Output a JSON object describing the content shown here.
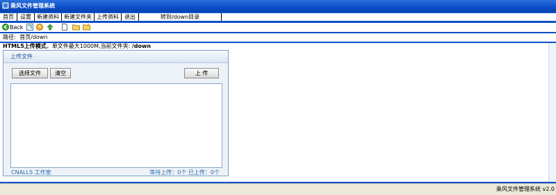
{
  "app": {
    "title": "乘风文件管理系统"
  },
  "menu": {
    "items": [
      {
        "label": "首页"
      },
      {
        "label": "设置"
      },
      {
        "label": "新建资料"
      },
      {
        "label": "新建文件夹"
      },
      {
        "label": "上传资料"
      },
      {
        "label": "退出"
      }
    ],
    "goto_label": "转到/down目录"
  },
  "toolbar": {
    "back_label": "Back",
    "icons": [
      "back-icon",
      "refresh-icon",
      "home-icon",
      "up-folder-icon",
      "new-file-icon",
      "open-folder-icon",
      "new-folder-icon"
    ]
  },
  "path": {
    "label": "路径:",
    "value": "首页/down"
  },
  "upload": {
    "mode_label": "HTML5上传模式",
    "info": "，单文件最大1000M,当前文件夹:",
    "folder": "/down",
    "panel_title": "上传文件",
    "select_button": "选择文件",
    "clear_button": "清空",
    "upload_button": "上 传",
    "footer_left": "CNALLS 工作室",
    "footer_right": "等待上传：0个 已上传：0个"
  },
  "status": {
    "text": "乘风文件管理系统 v2.0"
  },
  "colors": {
    "accent": "#0a4fc8",
    "panel_border": "#7f9cc8",
    "panel_bg": "#edf2f9",
    "footer_text": "#2a6aa8"
  }
}
